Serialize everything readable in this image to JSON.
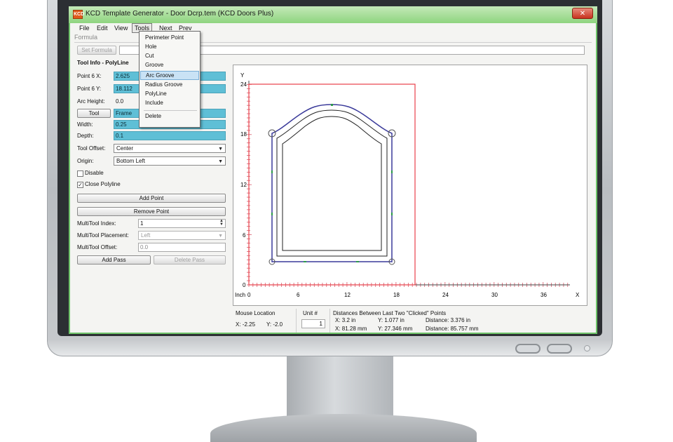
{
  "window": {
    "title": "KCD Template Generator - Door Dcrp.tem      (KCD Doors Plus)",
    "icon_text": "KCD",
    "close_glyph": "✕"
  },
  "menubar": [
    "File",
    "Edit",
    "View",
    "Tools",
    "Next",
    "Prev"
  ],
  "tools_menu": {
    "items": [
      "Perimeter Point",
      "Hole",
      "Cut",
      "Groove",
      "Arc Groove",
      "Radius Groove",
      "PolyLine",
      "Include",
      "Delete"
    ],
    "highlighted": "Arc Groove"
  },
  "formula": {
    "group_label": "Formula",
    "set_button": "Set Formula"
  },
  "tool_info": {
    "heading": "Tool Info - PolyLine",
    "point_x_label": "Point 6 X:",
    "point_x_value": "2.625",
    "point_y_label": "Point 6 Y:",
    "point_y_value": "18.112",
    "arc_height_label": "Arc Height:",
    "arc_height_value": "0.0",
    "tool_button": "Tool",
    "tool_value": "Frame",
    "width_label": "Width:",
    "width_value": "0.25",
    "depth_label": "Depth:",
    "depth_value": "0.1",
    "tool_offset_label": "Tool Offset:",
    "tool_offset_value": "Center",
    "origin_label": "Origin:",
    "origin_value": "Bottom Left",
    "disable_label": "Disable",
    "disable_checked": false,
    "close_polyline_label": "Close Polyline",
    "close_polyline_checked": true,
    "add_point_button": "Add Point",
    "remove_point_button": "Remove Point",
    "multitool_index_label": "MultiTool Index:",
    "multitool_index_value": "1",
    "multitool_placement_label": "MultiTool Placement:",
    "multitool_placement_value": "Left",
    "multitool_offset_label": "MultiTool Offset:",
    "multitool_offset_value": "0.0",
    "add_pass_button": "Add Pass",
    "delete_pass_button": "Delete Pass"
  },
  "drawing": {
    "y_axis_label": "Y",
    "x_axis_label": "X",
    "unit_label": "Inch",
    "y_ticks": [
      "0",
      "6",
      "12",
      "18",
      "24"
    ],
    "x_ticks": [
      "0",
      "6",
      "12",
      "18",
      "24",
      "30",
      "36"
    ],
    "colors": {
      "boundary": "#e8404a",
      "profile": "#3a3a9a",
      "outline": "#222222",
      "tick": "#d85a6a",
      "marker": "#2c9a4a"
    }
  },
  "status": {
    "mouse_location_label": "Mouse Location",
    "mouse_x": "X: -2.25",
    "mouse_y": "Y: -2.0",
    "unit_label": "Unit #",
    "unit_value": "1",
    "distances_label": "Distances Between Last Two \"Clicked\" Points",
    "dx_in": "X:  3.2 in",
    "dy_in": "Y:  1.077 in",
    "dist_in": "Distance:  3.376 in",
    "dx_mm": "X:  81.28 mm",
    "dy_mm": "Y:  27.346 mm",
    "dist_mm": "Distance:  85.757 mm"
  }
}
